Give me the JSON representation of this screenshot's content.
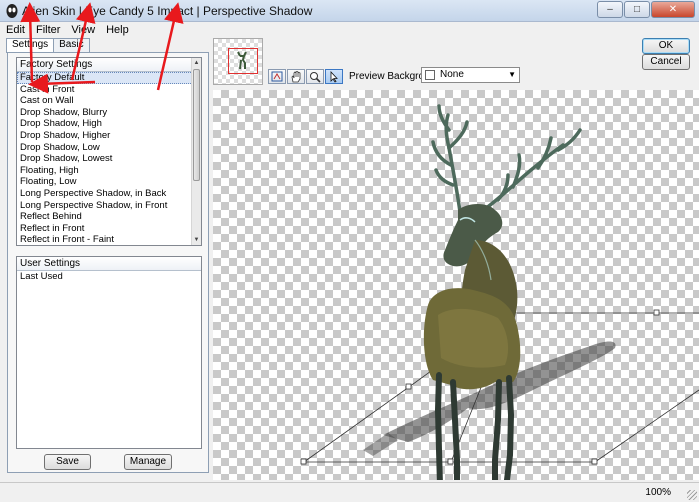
{
  "window": {
    "title": "Alien Skin | Eye Candy 5 Impact | Perspective Shadow",
    "minimize": "–",
    "maximize": "□",
    "close": "✕"
  },
  "menu": [
    "Edit",
    "Filter",
    "View",
    "Help"
  ],
  "tabs": [
    "Settings",
    "Basic"
  ],
  "factory": {
    "header": "Factory Settings",
    "items": [
      "Factory Default",
      "Cast in Front",
      "Cast on Wall",
      "Drop Shadow, Blurry",
      "Drop Shadow, High",
      "Drop Shadow, Higher",
      "Drop Shadow, Low",
      "Drop Shadow, Lowest",
      "Floating, High",
      "Floating, Low",
      "Long Perspective Shadow, in Back",
      "Long Perspective Shadow, in Front",
      "Reflect Behind",
      "Reflect in Front",
      "Reflect in Front - Faint"
    ],
    "selected_index": 0
  },
  "user": {
    "header": "User Settings",
    "items": [
      "Last Used"
    ]
  },
  "buttons": {
    "save": "Save",
    "manage": "Manage",
    "ok": "OK",
    "cancel": "Cancel"
  },
  "preview": {
    "tools": [
      "grab-icon",
      "hand-icon",
      "zoom-icon",
      "pointer-icon"
    ],
    "bg_label": "Preview Background:",
    "bg_value": "None"
  },
  "status": {
    "zoom": "100%"
  },
  "colors": {
    "annotation_arrow": "#e8191d",
    "thumb_frame": "#e03030"
  }
}
